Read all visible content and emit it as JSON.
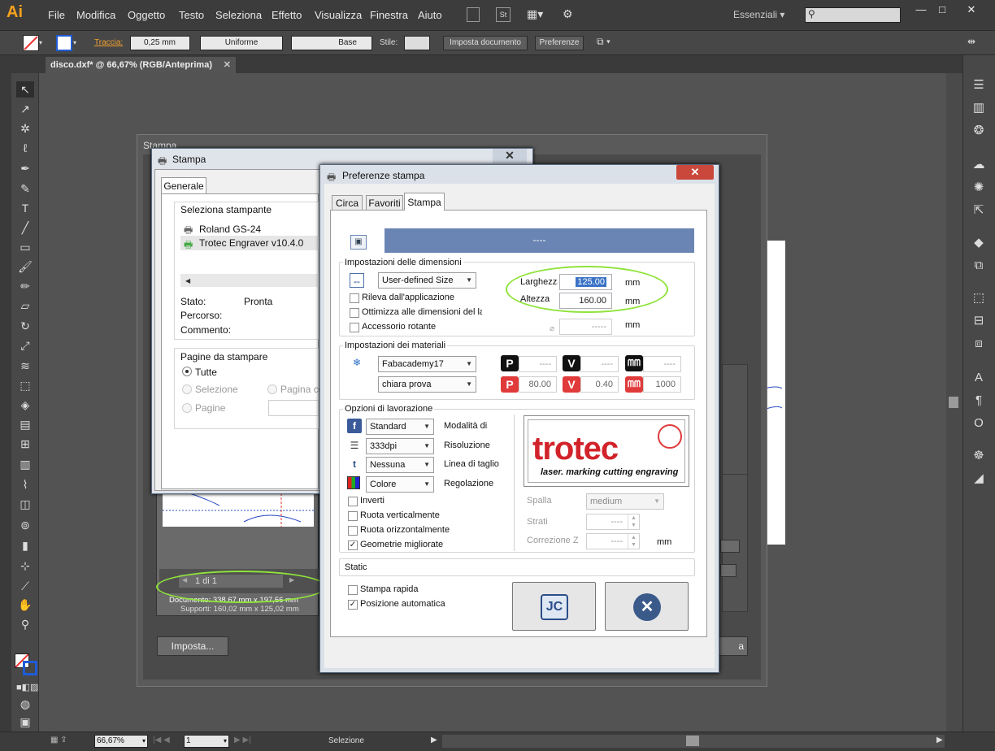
{
  "app": {
    "logo_text": "Ai",
    "menu": [
      "File",
      "Modifica",
      "Oggetto",
      "Testo",
      "Seleziona",
      "Effetto",
      "Visualizza",
      "Finestra",
      "Aiuto"
    ],
    "workspace": "Essenziali",
    "window_buttons": [
      "—",
      "□",
      "✕"
    ]
  },
  "controlbar": {
    "stroke_label": "Traccia:",
    "stroke_value": "0,25 mm",
    "profile": "Uniforme",
    "brush": "Base",
    "style_label": "Stile:",
    "doc_setup": "Imposta documento",
    "prefs": "Preferenze"
  },
  "document": {
    "tab_title": "disco.dxf* @ 66,67% (RGB/Anteprima)"
  },
  "statusbar": {
    "zoom": "66,67%",
    "page": "1",
    "tool": "Selezione"
  },
  "stampa": {
    "outer_title": "Stampa",
    "page_nav": "1 di 1",
    "doc_size": "Documento: 338,67 mm x 197,56 mm",
    "supp_size": "Supporti: 160,02 mm x 125,02 mm",
    "imposta": "Imposta...",
    "right_btn_partial": "a"
  },
  "win_stampa": {
    "title": "Stampa",
    "tab": "Generale",
    "select_printer": "Seleziona stampante",
    "printers": [
      "Roland GS-24",
      "Trotec Engraver v10.4.0"
    ],
    "status_label": "Stato:",
    "status_value": "Pronta",
    "location_label": "Percorso:",
    "comment_label": "Commento:",
    "pages_group": "Pagine da stampare",
    "opt_all": "Tutte",
    "opt_selection": "Selezione",
    "opt_current": "Pagina co",
    "opt_pages": "Pagine"
  },
  "pref": {
    "title": "Preferenze stampa",
    "tabs": [
      "Circa",
      "Favoriti",
      "Stampa"
    ],
    "blue_bar": "----",
    "dimensions": {
      "group": "Impostazioni delle dimensioni",
      "size_combo": "User-defined Size",
      "detect": "Rileva dall'applicazione",
      "optimize": "Ottimizza alle dimensioni del la",
      "rotary": "Accessorio rotante",
      "width_label": "Larghezza",
      "width_value": "125.00",
      "height_label": "Altezza",
      "height_value": "160.00",
      "unit": "mm",
      "diam_value": "-----"
    },
    "materials": {
      "group": "Impostazioni dei materiali",
      "material": "Fabacademy17",
      "setting": "chiara prova",
      "p_top": "----",
      "v_top": "----",
      "f_top": "----",
      "p_bottom": "80.00",
      "v_bottom": "0.40",
      "f_bottom": "1000"
    },
    "processing": {
      "group": "Opzioni di lavorazione",
      "mode_combo": "Standard",
      "mode_label": "Modalità di",
      "res_combo": "333dpi",
      "res_label": "Risoluzione",
      "cut_combo": "Nessuna",
      "cut_label": "Linea di taglio",
      "color_combo": "Colore",
      "color_label": "Regolazione",
      "invert": "Inverti",
      "rot_v": "Ruota verticalmente",
      "rot_h": "Ruota orizzontalmente",
      "improved": "Geometrie migliorate",
      "thickness_label": "Spalla",
      "thickness_value": "medium",
      "layers_label": "Strati",
      "layers_value": "----",
      "zcorr_label": "Correzione Z",
      "zcorr_value": "----",
      "zcorr_unit": "mm"
    },
    "static_label": "Static",
    "quick_print": "Stampa rapida",
    "auto_position": "Posizione automatica",
    "logo": {
      "brand": "trotec",
      "tagline": "laser. marking cutting engraving"
    },
    "jc_label": "JC"
  },
  "colors": {
    "highlight": "#8fe33b",
    "trotec_red": "#d2232a",
    "pv_red": "#e03a3a",
    "pv_black": "#111111",
    "blue_bar": "#6a85b3"
  }
}
